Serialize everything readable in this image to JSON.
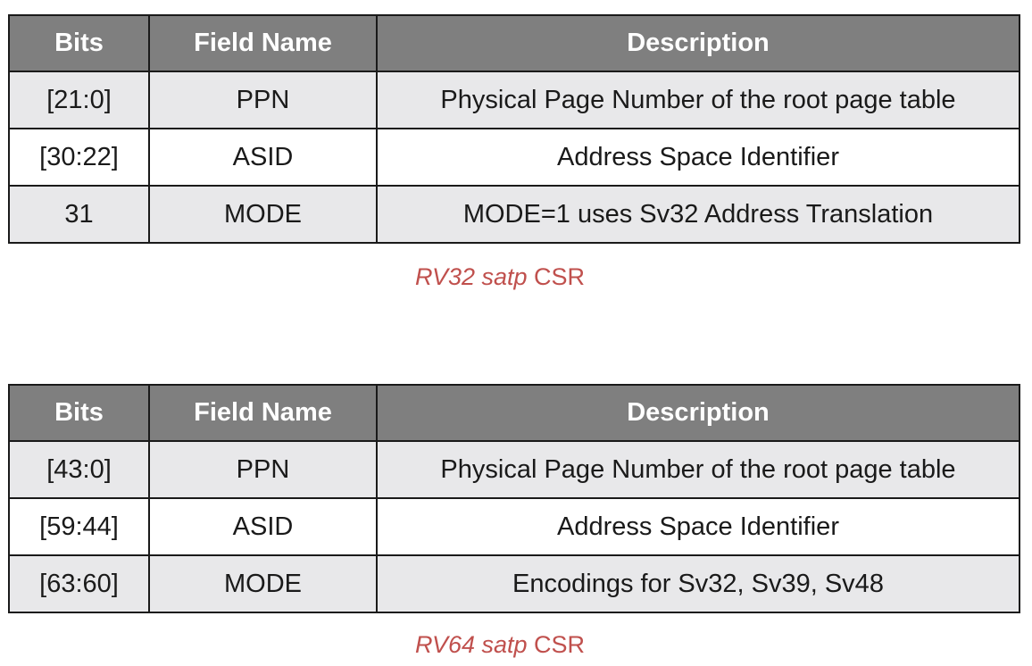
{
  "tables": [
    {
      "header": {
        "bits": "Bits",
        "field_name": "Field Name",
        "description": "Description"
      },
      "rows": [
        {
          "bits": "[21:0]",
          "field": "PPN",
          "description": "Physical Page Number of the root page table"
        },
        {
          "bits": "[30:22]",
          "field": "ASID",
          "description": "Address Space Identifier"
        },
        {
          "bits": "31",
          "field": "MODE",
          "description": "MODE=1 uses Sv32 Address Translation"
        }
      ],
      "caption": {
        "italic_part": "RV32 satp",
        "rest": " CSR"
      }
    },
    {
      "header": {
        "bits": "Bits",
        "field_name": "Field Name",
        "description": "Description"
      },
      "rows": [
        {
          "bits": "[43:0]",
          "field": "PPN",
          "description": "Physical Page Number of the root page table"
        },
        {
          "bits": "[59:44]",
          "field": "ASID",
          "description": "Address Space Identifier"
        },
        {
          "bits": "[63:60]",
          "field": "MODE",
          "description": "Encodings for Sv32, Sv39, Sv48"
        }
      ],
      "caption": {
        "italic_part": "RV64 satp",
        "rest": " CSR"
      }
    }
  ],
  "colors": {
    "header_bg": "#7f7f7f",
    "header_text": "#ffffff",
    "row_shaded": "#e8e8ea",
    "border": "#1a1a1a",
    "caption": "#c0504d"
  }
}
